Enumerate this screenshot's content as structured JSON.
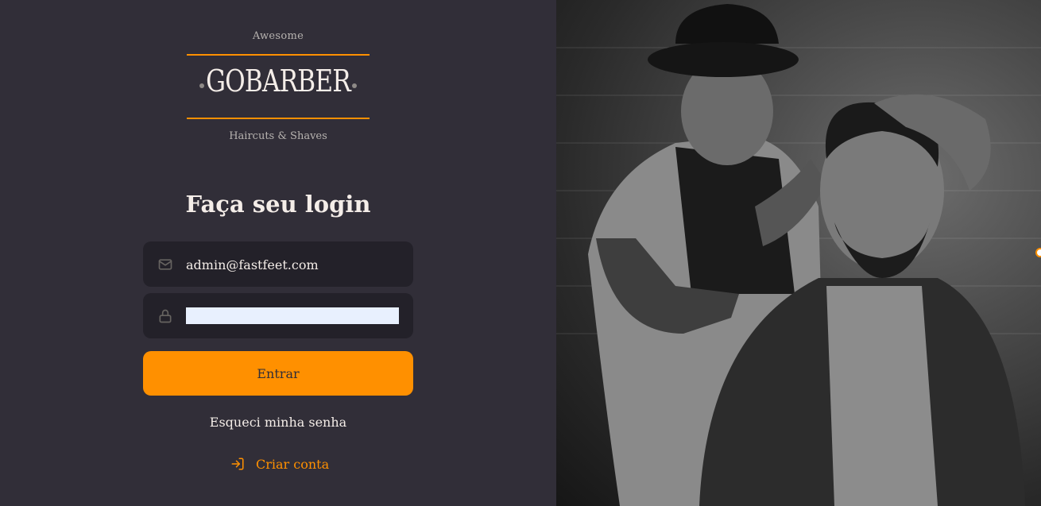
{
  "brand": {
    "tagline_top": "Awesome",
    "name": "GOBARBER",
    "tagline_bottom": "Haircuts & Shaves"
  },
  "form": {
    "title": "Faça seu login",
    "email": {
      "value": "admin@fastfeet.com",
      "icon": "mail-icon"
    },
    "password": {
      "value": "",
      "icon": "lock-icon"
    },
    "submit_label": "Entrar",
    "forgot_label": "Esqueci minha senha"
  },
  "signup": {
    "label": "Criar conta",
    "icon": "log-in-icon"
  },
  "colors": {
    "background": "#312e38",
    "input_background": "#232129",
    "accent": "#ff9000",
    "text": "#f4ede8"
  }
}
